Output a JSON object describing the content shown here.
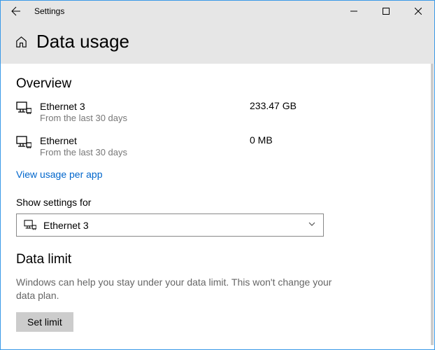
{
  "window": {
    "title": "Settings"
  },
  "header": {
    "page_title": "Data usage"
  },
  "overview": {
    "heading": "Overview",
    "connections": [
      {
        "name": "Ethernet 3",
        "subtitle": "From the last 30 days",
        "usage": "233.47 GB"
      },
      {
        "name": "Ethernet",
        "subtitle": "From the last 30 days",
        "usage": "0 MB"
      }
    ],
    "link": "View usage per app"
  },
  "settings_for": {
    "label": "Show settings for",
    "selected": "Ethernet 3"
  },
  "data_limit": {
    "heading": "Data limit",
    "description": "Windows can help you stay under your data limit. This won't change your data plan.",
    "button": "Set limit"
  }
}
